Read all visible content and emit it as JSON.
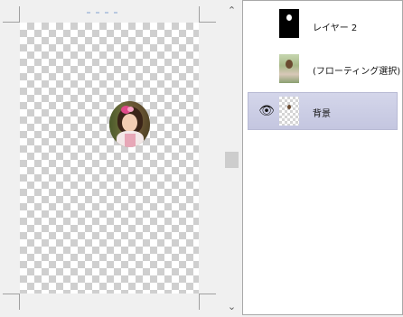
{
  "canvas": {
    "transparency_pattern": "checkerboard"
  },
  "scrollbar": {
    "up_icon": "chevron-up-icon",
    "down_icon": "chevron-down-icon",
    "up_glyph": "⌃",
    "down_glyph": "⌄"
  },
  "layers": [
    {
      "name": "レイヤー 2",
      "visible": false,
      "selected": false
    },
    {
      "name": "(フローティング選択)",
      "visible": false,
      "selected": false
    },
    {
      "name": "背景",
      "visible": true,
      "selected": true,
      "eye_glyph": "👁"
    }
  ],
  "colors": {
    "selection_bg": "#c8cae2",
    "panel_bg": "#ffffff",
    "window_bg": "#f0f0f0"
  }
}
